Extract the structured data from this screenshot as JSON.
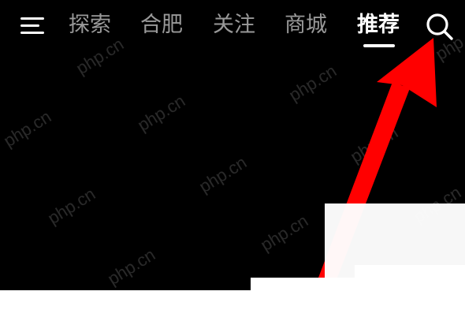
{
  "nav": {
    "tabs": [
      {
        "label": "探索"
      },
      {
        "label": "合肥"
      },
      {
        "label": "关注"
      },
      {
        "label": "商城"
      },
      {
        "label": "推荐"
      }
    ],
    "active_tab": "推荐",
    "icons": {
      "menu": "menu-icon",
      "search": "search-icon"
    }
  },
  "watermark": {
    "text": "php.cn"
  },
  "annotation": {
    "arrow_color": "#ff0000",
    "target": "search-button"
  }
}
